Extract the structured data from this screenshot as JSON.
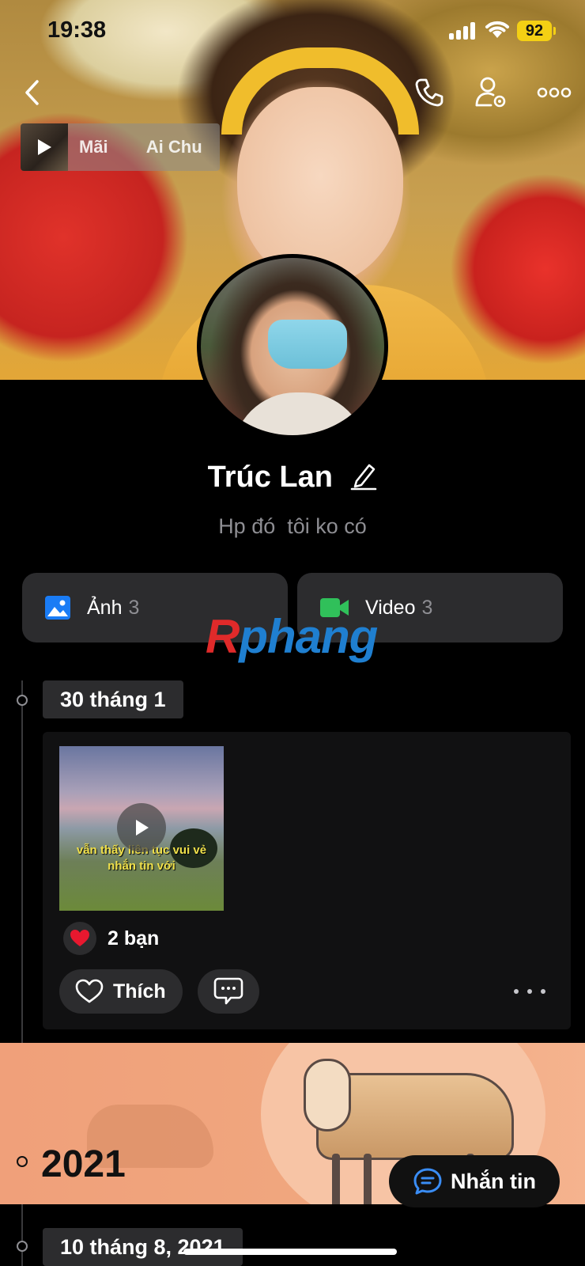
{
  "status_bar": {
    "time": "19:38",
    "battery": "92"
  },
  "music": {
    "text": "Mãi        Ai Chu"
  },
  "profile": {
    "name": "Trúc Lan",
    "bio": "Hp đó  tôi ko có"
  },
  "media": [
    {
      "label": "Ảnh",
      "count": "3",
      "icon": "photo-icon",
      "color": "#1a7cf5"
    },
    {
      "label": "Video",
      "count": "3",
      "icon": "video-icon",
      "color": "#30c05a"
    }
  ],
  "watermark": {
    "first": "R",
    "rest": "phang"
  },
  "timeline": {
    "date1": "30 tháng 1",
    "post": {
      "caption_line1": "vẫn thấy liên tục vui vẻ",
      "caption_line2": "nhắn tin với",
      "likes": "2 bạn",
      "like_label": "Thích"
    },
    "year": "2021",
    "date2": "10 tháng 8, 2021"
  },
  "message_button": {
    "label": "Nhắn tin"
  }
}
